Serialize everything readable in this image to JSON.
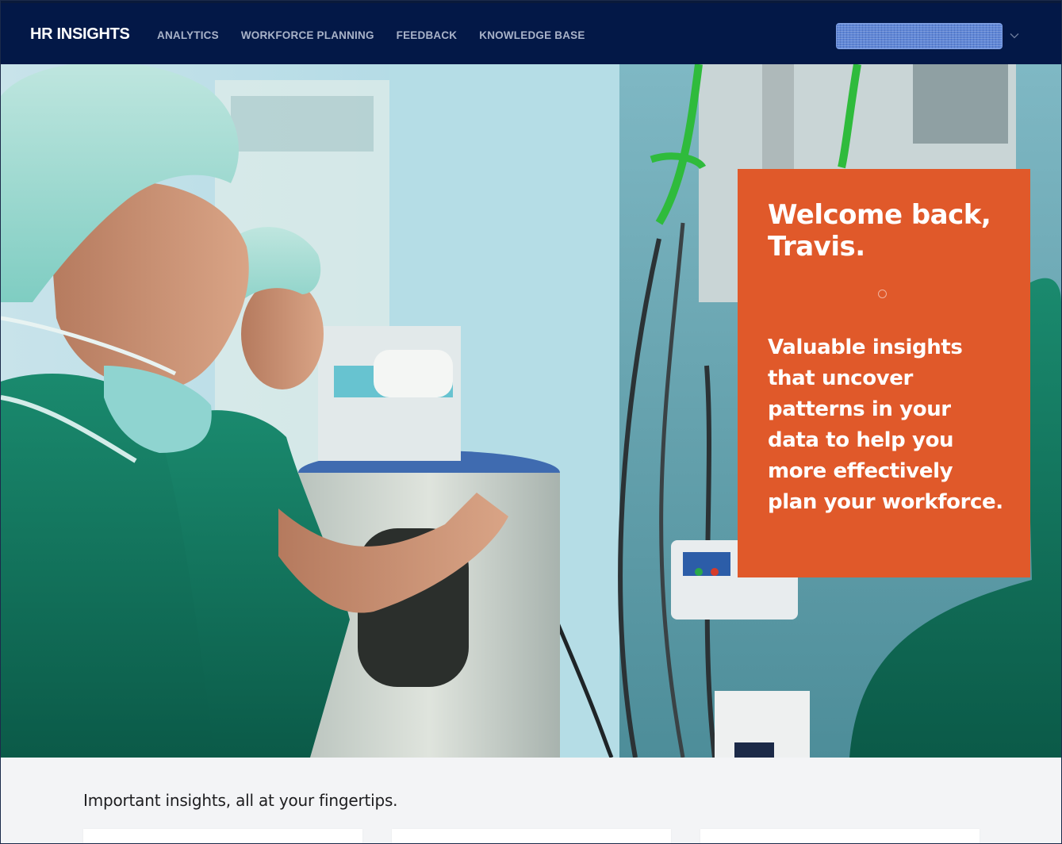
{
  "nav": {
    "brand": "HR INSIGHTS",
    "links": [
      {
        "label": "ANALYTICS"
      },
      {
        "label": "WORKFORCE PLANNING"
      },
      {
        "label": "FEEDBACK"
      },
      {
        "label": "KNOWLEDGE BASE"
      }
    ],
    "user_menu_icon": "chevron-down-icon"
  },
  "hero": {
    "welcome_title": "Welcome back, Travis.",
    "welcome_body": "Valuable insights that uncover patterns in your data to help you more effectively plan your workforce.",
    "carousel_indicator_icon": "circle-dot-icon"
  },
  "insights": {
    "heading": "Important insights, all at your fingertips."
  },
  "colors": {
    "nav_background": "#031847",
    "accent_orange": "#e0592a",
    "page_background": "#f3f4f6"
  }
}
